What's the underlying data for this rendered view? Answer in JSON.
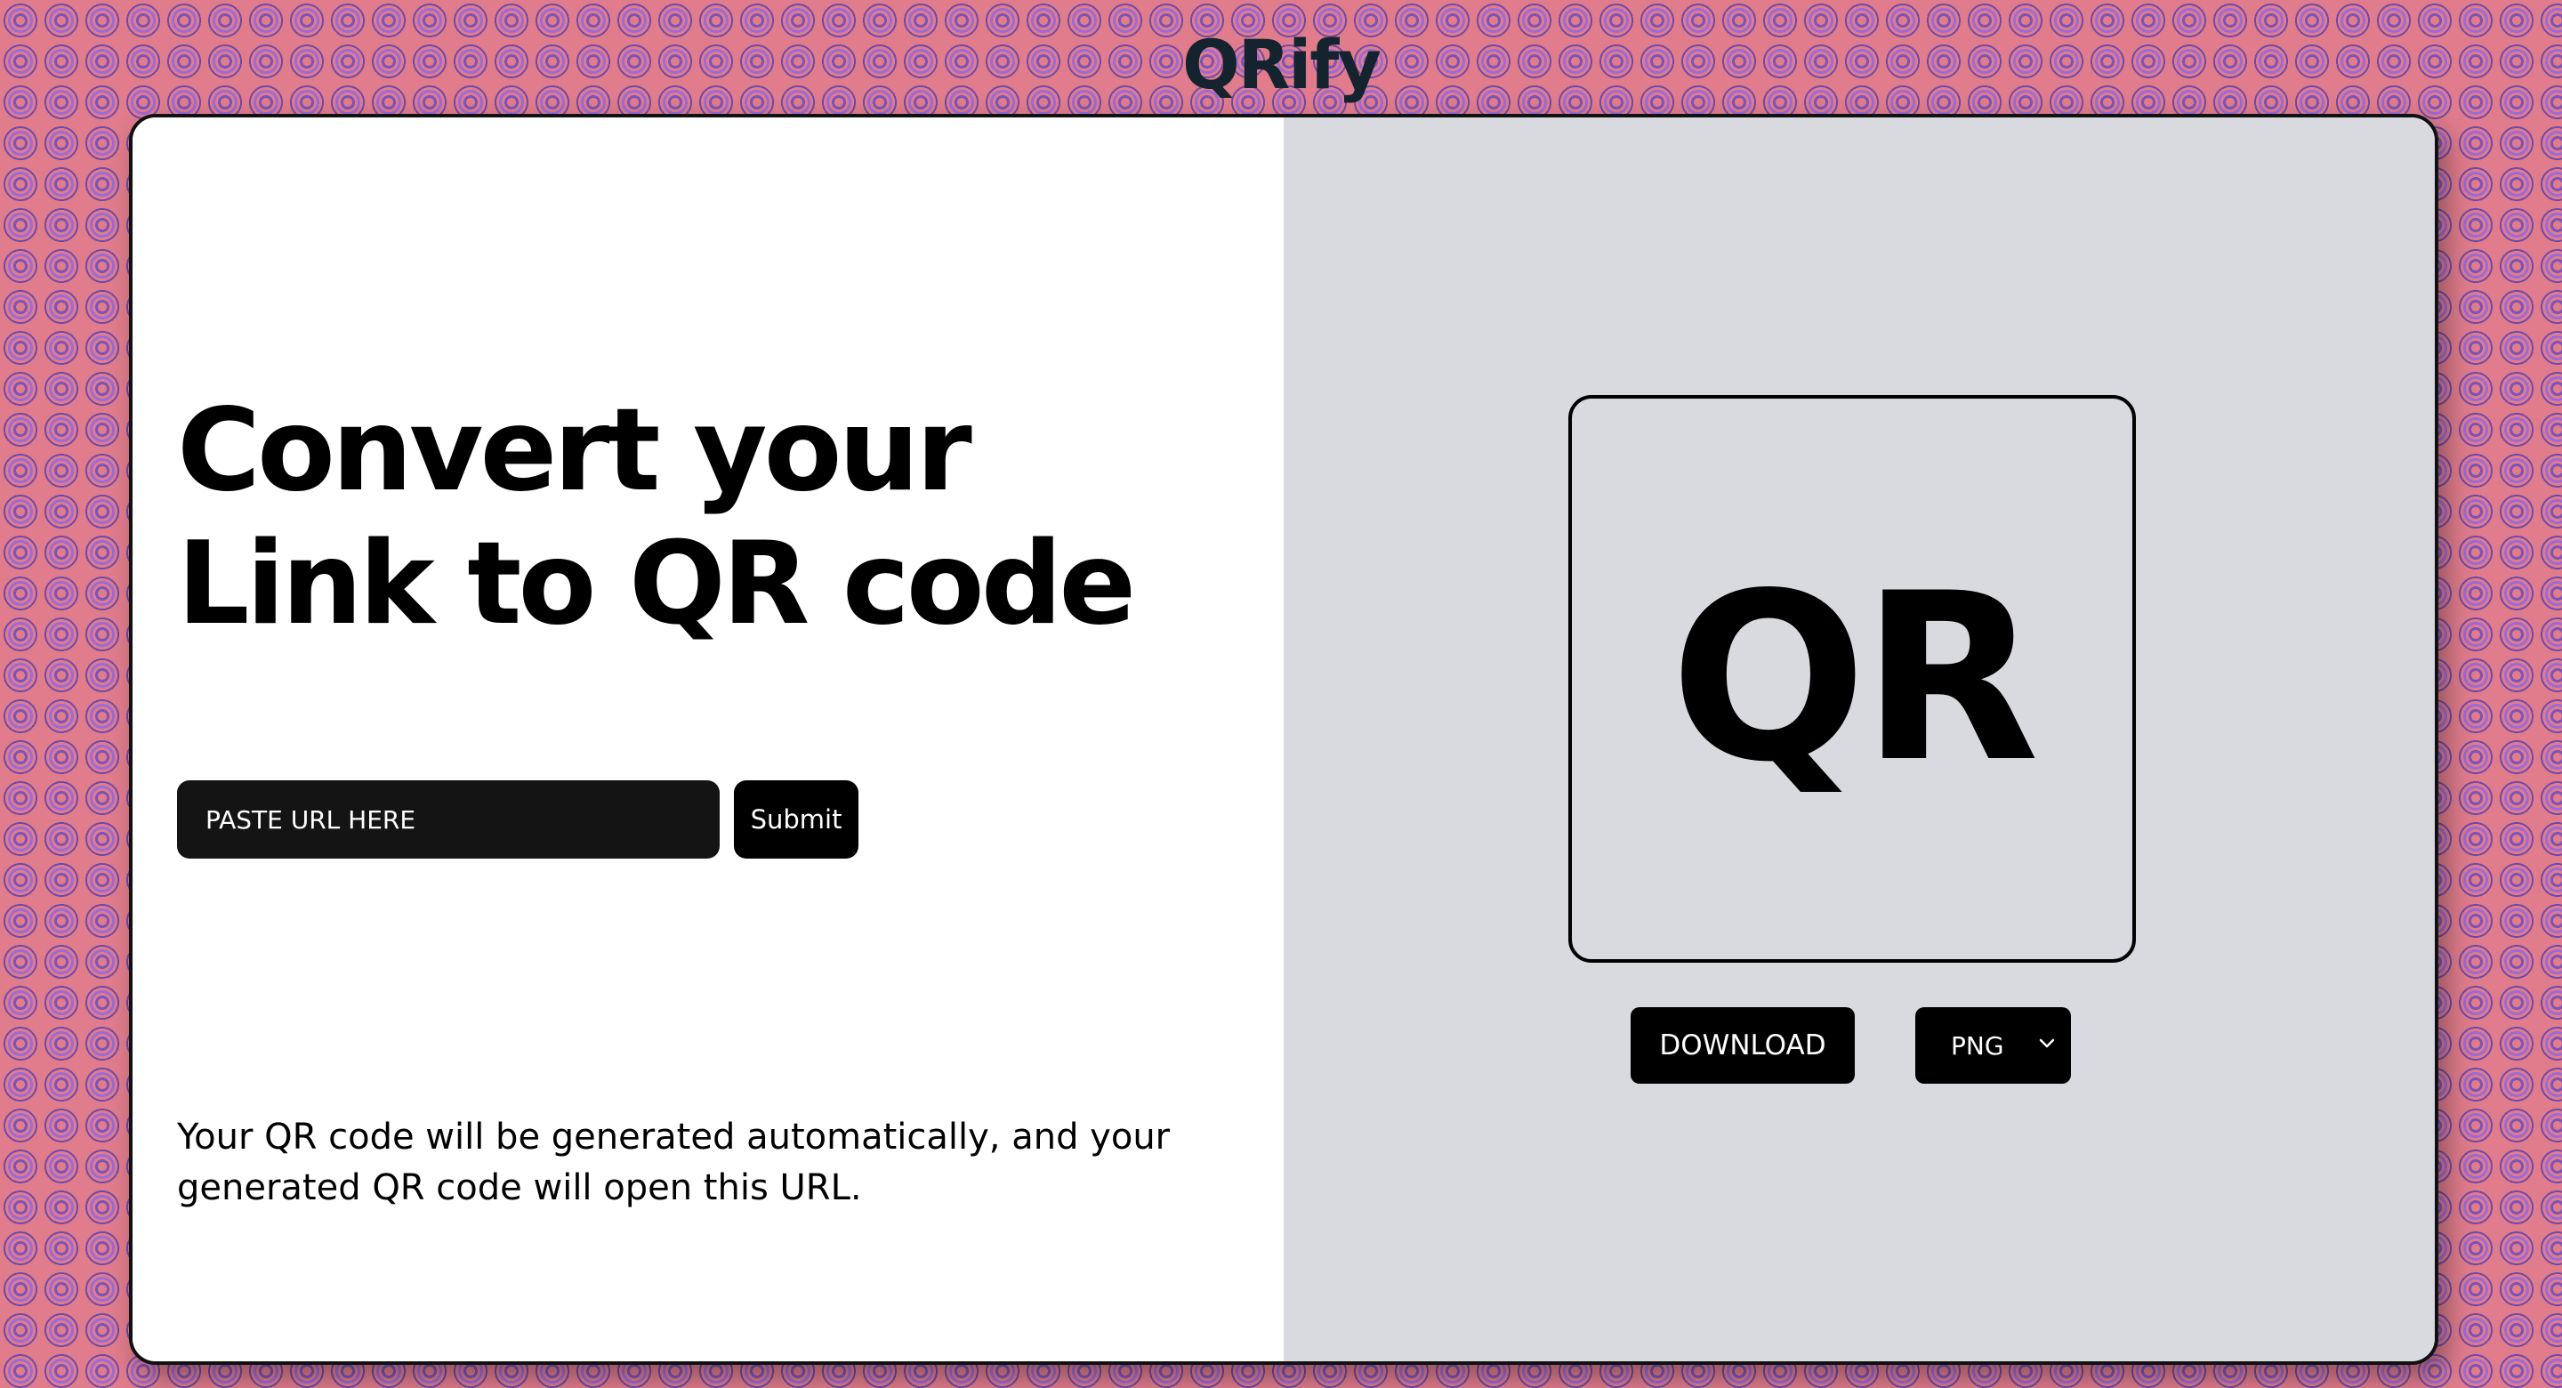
{
  "app": {
    "brand": "QRify"
  },
  "left": {
    "headline_line1": "Convert your",
    "headline_line2": "Link to QR code",
    "url_input": {
      "placeholder": "PASTE URL HERE",
      "value": ""
    },
    "submit_label": "Submit",
    "helper_text": "Your QR code will be generated automatically, and your generated QR code will open this URL."
  },
  "right": {
    "qr_placeholder": "QR",
    "download_label": "DOWNLOAD",
    "format_select": {
      "selected": "PNG"
    }
  },
  "icons": {
    "format_select_arrow": "chevron-down-icon"
  },
  "colors": {
    "background": "#e07c8c",
    "pattern": "#7b54b8",
    "brand_text": "#14232e",
    "left_panel": "#ffffff",
    "right_panel": "#d9dadf",
    "button": "#000000",
    "input": "#141414"
  }
}
